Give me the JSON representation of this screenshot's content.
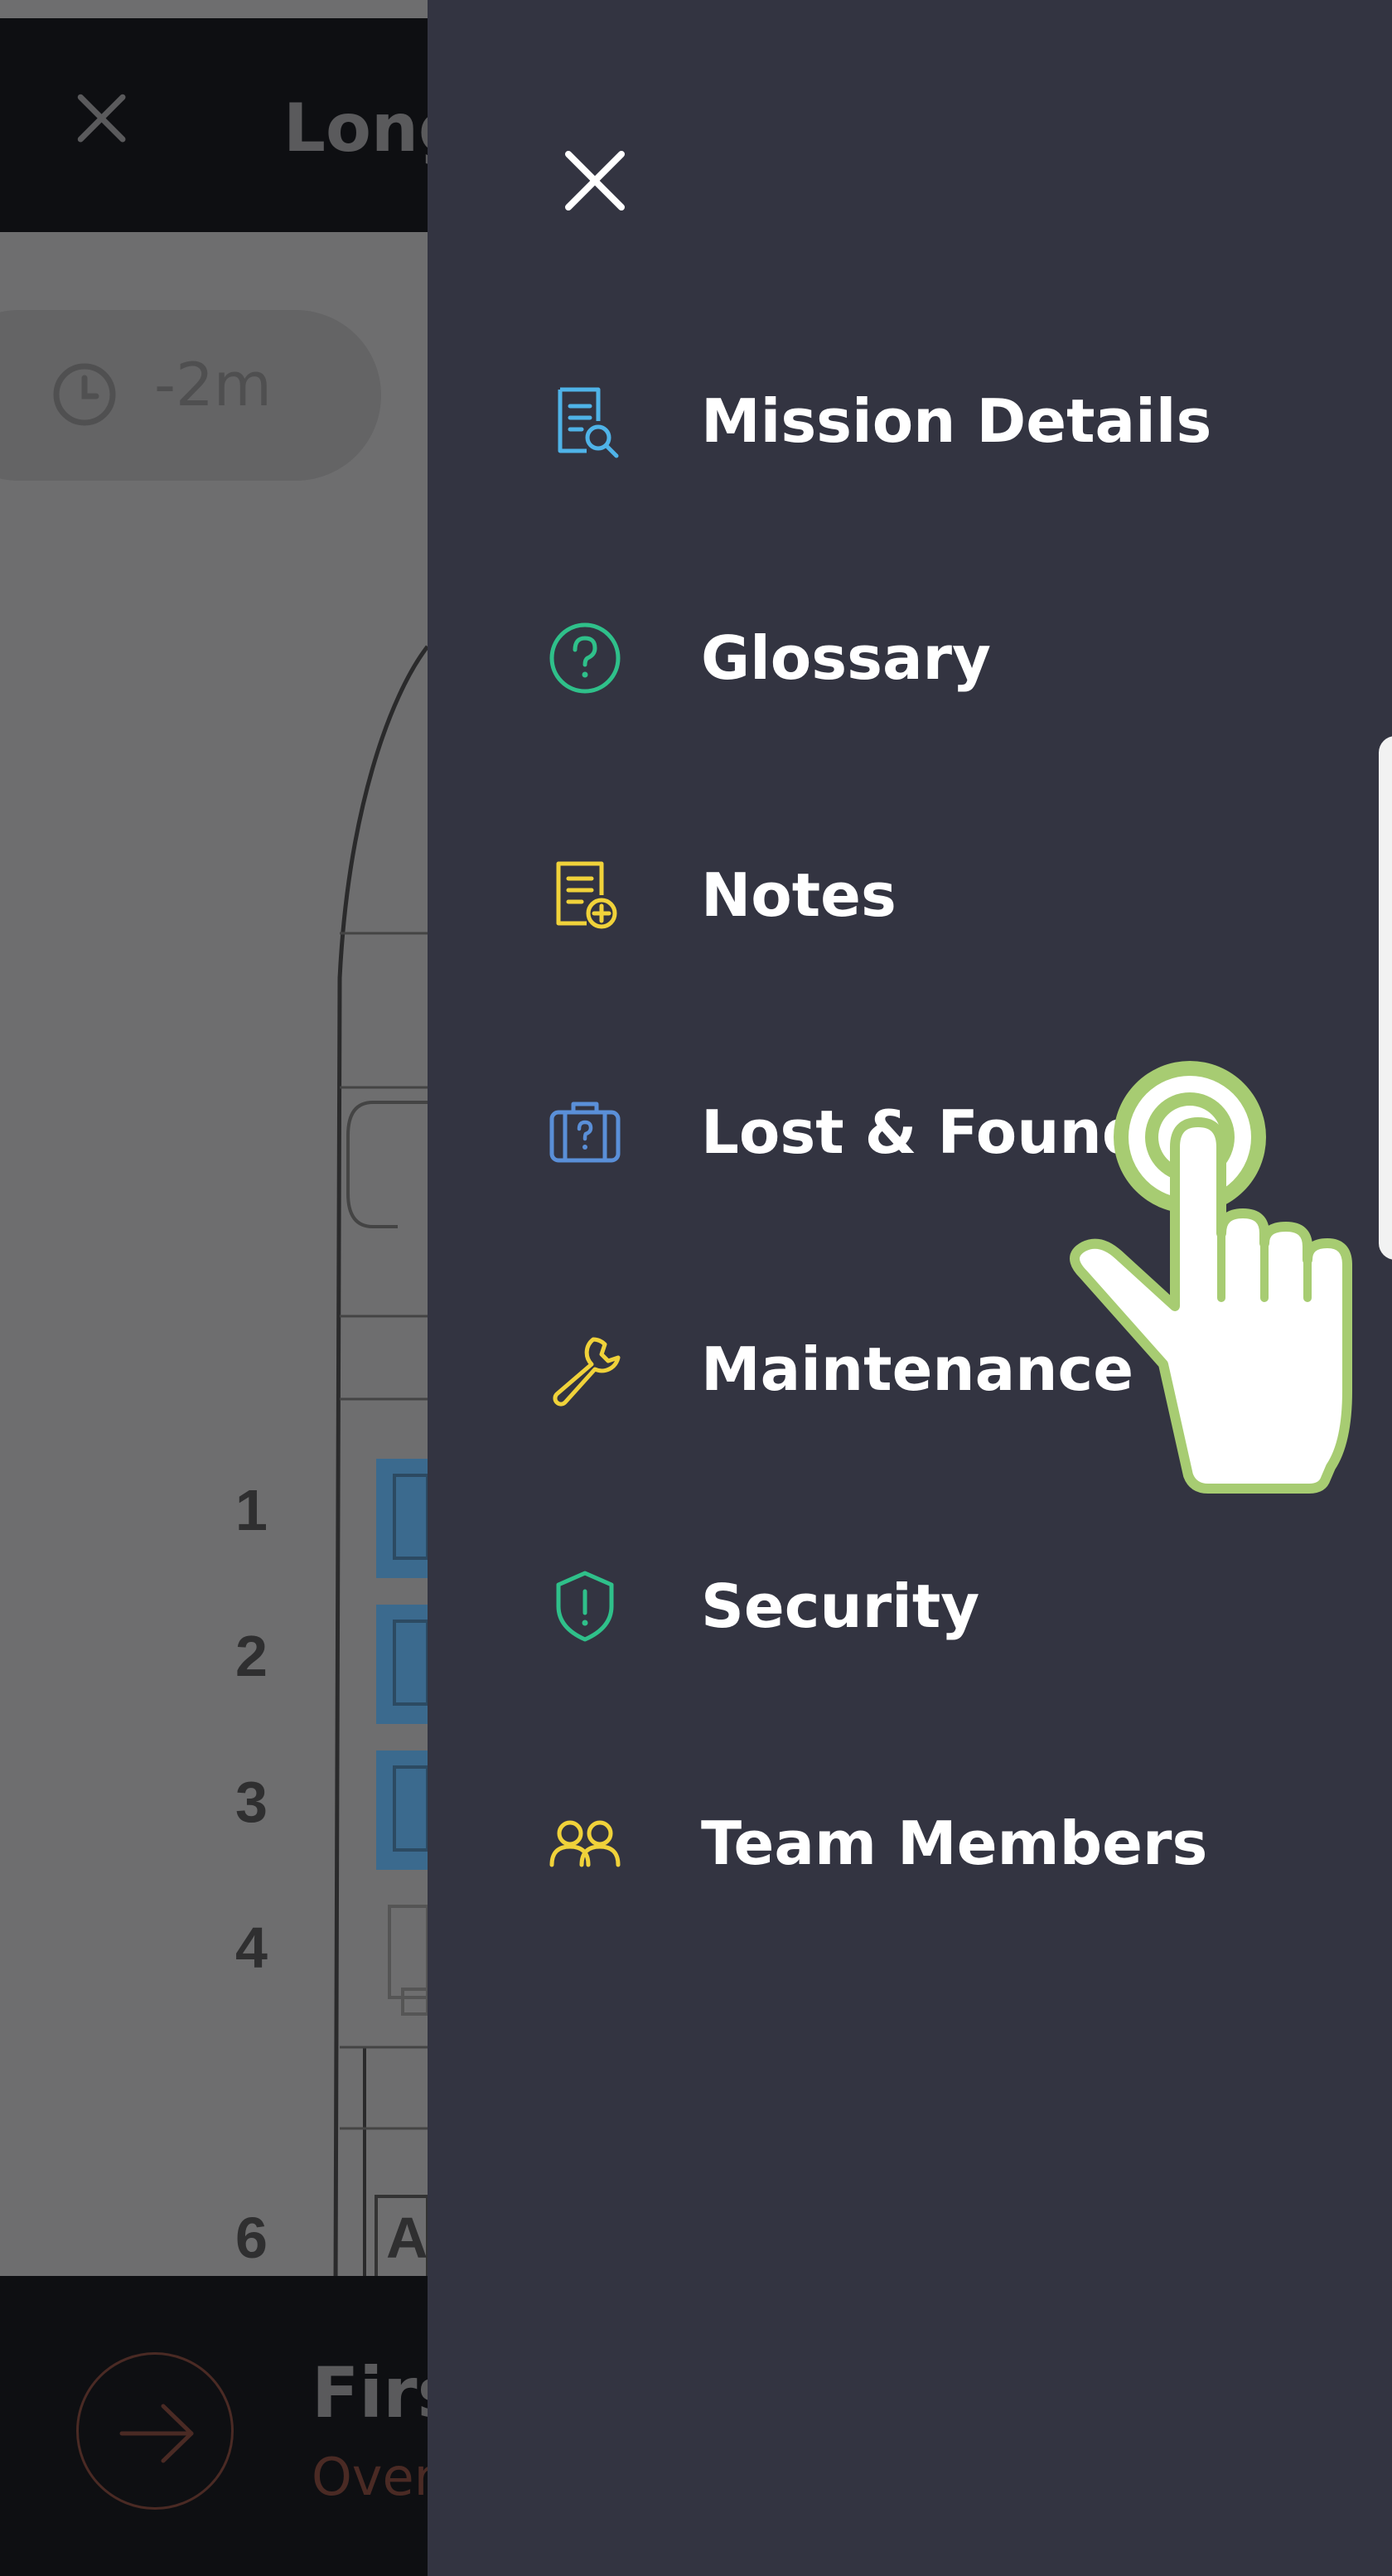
{
  "background_app": {
    "header_title": "Long",
    "time_badge": "-2m",
    "row_numbers": [
      "1",
      "2",
      "3",
      "4",
      "6"
    ],
    "seat_label": "A",
    "footer_title": "Firs",
    "footer_subtitle": "Over"
  },
  "drawer": {
    "items": [
      {
        "label": "Mission Details",
        "icon": "mission-details-icon",
        "color": "#4fb3e8"
      },
      {
        "label": "Glossary",
        "icon": "question-circle-icon",
        "color": "#2fc08a"
      },
      {
        "label": "Notes",
        "icon": "notes-add-icon",
        "color": "#f0d23a"
      },
      {
        "label": "Lost & Found",
        "icon": "luggage-icon",
        "color": "#5a8fd8"
      },
      {
        "label": "Maintenance",
        "icon": "wrench-icon",
        "color": "#f0d23a"
      },
      {
        "label": "Security",
        "icon": "shield-alert-icon",
        "color": "#2fc08a"
      },
      {
        "label": "Team Members",
        "icon": "team-icon",
        "color": "#f0d23a"
      }
    ]
  },
  "colors": {
    "drawer_bg": "#333441",
    "tap_indicator": "#a7cc72"
  }
}
